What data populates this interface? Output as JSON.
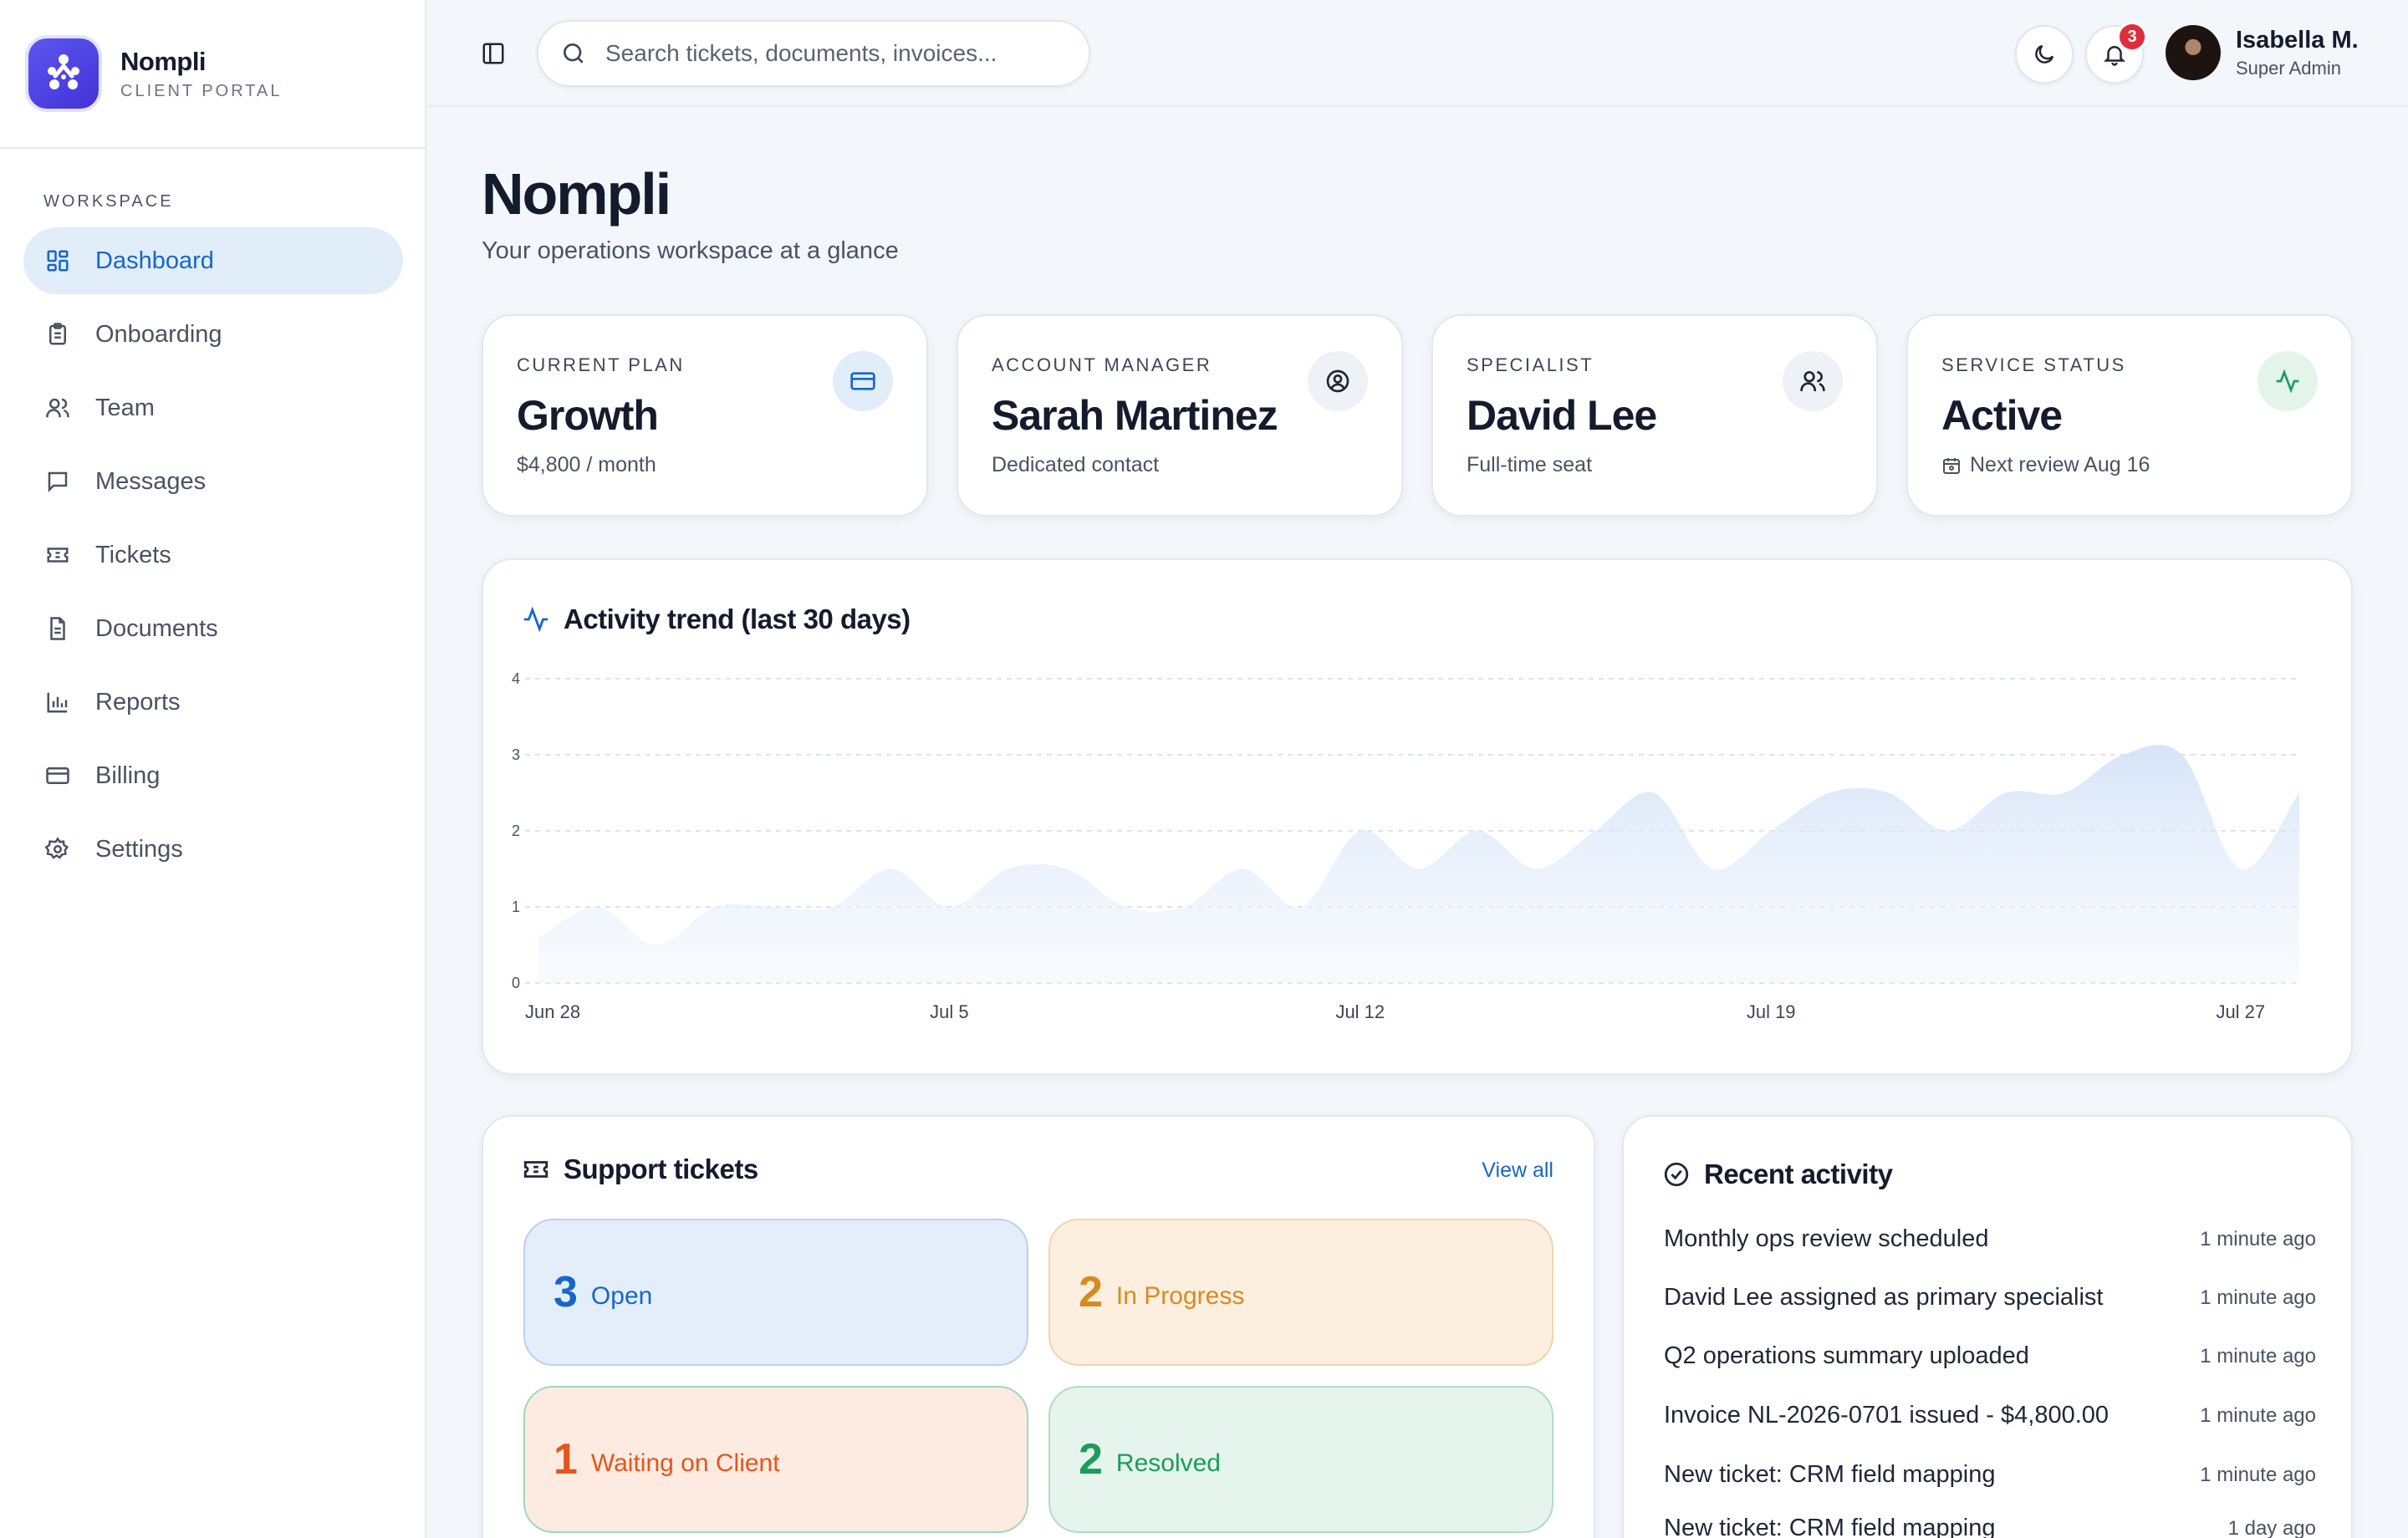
{
  "brand": {
    "name": "Nompli",
    "subtitle": "CLIENT PORTAL"
  },
  "sidebar": {
    "section_label": "WORKSPACE",
    "items": [
      {
        "label": "Dashboard",
        "icon": "dashboard-icon",
        "active": true
      },
      {
        "label": "Onboarding",
        "icon": "clipboard-icon"
      },
      {
        "label": "Team",
        "icon": "users-icon"
      },
      {
        "label": "Messages",
        "icon": "message-icon"
      },
      {
        "label": "Tickets",
        "icon": "ticket-icon"
      },
      {
        "label": "Documents",
        "icon": "document-icon"
      },
      {
        "label": "Reports",
        "icon": "bar-chart-icon"
      },
      {
        "label": "Billing",
        "icon": "credit-card-icon"
      },
      {
        "label": "Settings",
        "icon": "gear-icon"
      }
    ]
  },
  "topbar": {
    "search_placeholder": "Search tickets, documents, invoices...",
    "notification_count": "3",
    "user": {
      "name": "Isabella M.",
      "role": "Super Admin"
    }
  },
  "page": {
    "title": "Nompli",
    "subtitle": "Your operations workspace at a glance"
  },
  "stats": [
    {
      "label": "CURRENT PLAN",
      "value": "Growth",
      "sub": "$4,800 / month",
      "icon": "credit-card-icon"
    },
    {
      "label": "ACCOUNT MANAGER",
      "value": "Sarah Martinez",
      "sub": "Dedicated contact",
      "icon": "user-circle-icon"
    },
    {
      "label": "SPECIALIST",
      "value": "David Lee",
      "sub": "Full-time seat",
      "icon": "users-icon"
    },
    {
      "label": "SERVICE STATUS",
      "value": "Active",
      "sub": "Next review Aug 16",
      "icon": "activity-icon"
    }
  ],
  "colors": {
    "accent": "#1667c9",
    "active_bg": "#e2edfa",
    "status_green": "#1c9c5a",
    "badge_red": "#e02d3c"
  },
  "chart_data": {
    "type": "area",
    "title": "Activity trend (last 30 days)",
    "x_tick_labels": [
      "Jun 28",
      "Jul 5",
      "Jul 12",
      "Jul 19",
      "Jul 27"
    ],
    "x": [
      "Jun 28",
      "Jun 29",
      "Jun 30",
      "Jul 1",
      "Jul 2",
      "Jul 3",
      "Jul 4",
      "Jul 5",
      "Jul 6",
      "Jul 7",
      "Jul 8",
      "Jul 9",
      "Jul 10",
      "Jul 11",
      "Jul 12",
      "Jul 13",
      "Jul 14",
      "Jul 15",
      "Jul 16",
      "Jul 17",
      "Jul 18",
      "Jul 19",
      "Jul 20",
      "Jul 21",
      "Jul 22",
      "Jul 23",
      "Jul 24",
      "Jul 25",
      "Jul 26",
      "Jul 27"
    ],
    "series": [
      {
        "values": [
          0.6,
          1,
          0.5,
          1,
          1,
          1,
          1.5,
          1,
          1.5,
          1.5,
          1,
          1,
          1.5,
          1,
          2,
          1.5,
          2,
          1.5,
          2,
          2.5,
          1.5,
          2,
          2.5,
          2.5,
          2,
          2.5,
          2.5,
          3,
          3,
          1.5,
          2.5
        ]
      }
    ],
    "ylim": [
      0,
      4
    ],
    "y_ticks": [
      0,
      1,
      2,
      3,
      4
    ],
    "grid": true,
    "color": "#cfe0f7"
  },
  "tickets": {
    "title": "Support tickets",
    "view_all": "View all",
    "items": [
      {
        "count": "3",
        "label": "Open",
        "color": "#1667c9",
        "bg": "#e4eefa",
        "border": "#b9d2f1"
      },
      {
        "count": "2",
        "label": "In Progress",
        "color": "#d98a1f",
        "bg": "#fcefe0",
        "border": "#f3d4a9"
      },
      {
        "count": "1",
        "label": "Waiting on Client",
        "color": "#e3561b",
        "bg": "#fdebe2",
        "border": "#9fd8b8"
      },
      {
        "count": "2",
        "label": "Resolved",
        "color": "#1c9c5a",
        "bg": "#e5f4ec",
        "border": "#b0dcc4"
      }
    ]
  },
  "activity": {
    "title": "Recent activity",
    "items": [
      {
        "text": "Monthly ops review scheduled",
        "time": "1 minute ago"
      },
      {
        "text": "David Lee assigned as primary specialist",
        "time": "1 minute ago"
      },
      {
        "text": "Q2 operations summary uploaded",
        "time": "1 minute ago"
      },
      {
        "text": "Invoice NL-2026-0701 issued - $4,800.00",
        "time": "1 minute ago"
      },
      {
        "text": "New ticket: CRM field mapping",
        "time": "1 minute ago"
      },
      {
        "text": "New ticket: CRM field mapping",
        "time": "1 day ago"
      }
    ]
  }
}
